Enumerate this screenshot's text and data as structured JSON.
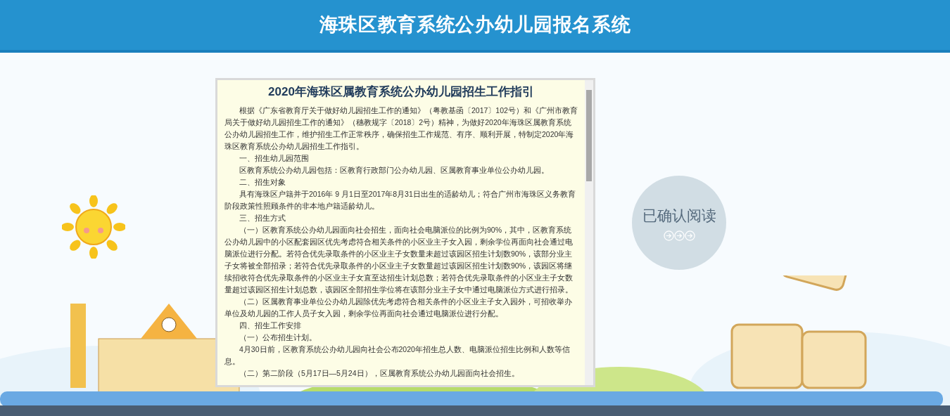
{
  "header": {
    "title": "海珠区教育系统公办幼儿园报名系统"
  },
  "guide": {
    "title": "2020年海珠区属教育系统公办幼儿园招生工作指引",
    "paragraphs": [
      "根据《广东省教育厅关于做好幼儿园招生工作的通知》（粤教基函〔2017〕102号）和《广州市教育局关于做好幼儿园招生工作的通知》（穗教规字〔2018〕2号）精神，为做好2020年海珠区属教育系统公办幼儿园招生工作，维护招生工作正常秩序，确保招生工作规范、有序、顺利开展，特制定2020年海珠区教育系统公办幼儿园招生工作指引。",
      "一、招生幼儿园范围",
      "区教育系统公办幼儿园包括：区教育行政部门公办幼儿园、区属教育事业单位公办幼儿园。",
      "二、招生对象",
      "具有海珠区户籍并于2016年 9 月1日至2017年8月31日出生的适龄幼儿；符合广州市海珠区义务教育阶段政策性照顾条件的非本地户籍适龄幼儿。",
      "三、招生方式",
      "（一）区教育系统公办幼儿园面向社会招生，面向社会电脑派位的比例为90%，其中，区教育系统公办幼儿园中的小区配套园区优先考虑符合相关条件的小区业主子女入园，剩余学位再面向社会通过电脑派位进行分配。若符合优先录取条件的小区业主子女数量未超过该园区招生计划数90%，该部分业主子女将被全部招录；若符合优先录取条件的小区业主子女数量超过该园区招生计划数90%，该园区将继续招收符合优先录取条件的小区业主子女直至达招生计划总数；若符合优先录取条件的小区业主子女数量超过该园区招生计划总数，该园区全部招生学位将在该部分业主子女中通过电脑派位方式进行招录。",
      "（二）区属教育事业单位公办幼儿园除优先考虑符合相关条件的小区业主子女入园外，可招收举办单位及幼儿园的工作人员子女入园，剩余学位再面向社会通过电脑派位进行分配。",
      "四、招生工作安排",
      "（一）公布招生计划。",
      "4月30日前，区教育系统公办幼儿园向社会公布2020年招生总人数、电脑派位招生比例和人数等信息。",
      "（二）第二阶段（5月17日—5月24日），区属教育系统公办幼儿园面向社会招生。"
    ]
  },
  "confirm_button": {
    "label": "已确认阅读"
  }
}
